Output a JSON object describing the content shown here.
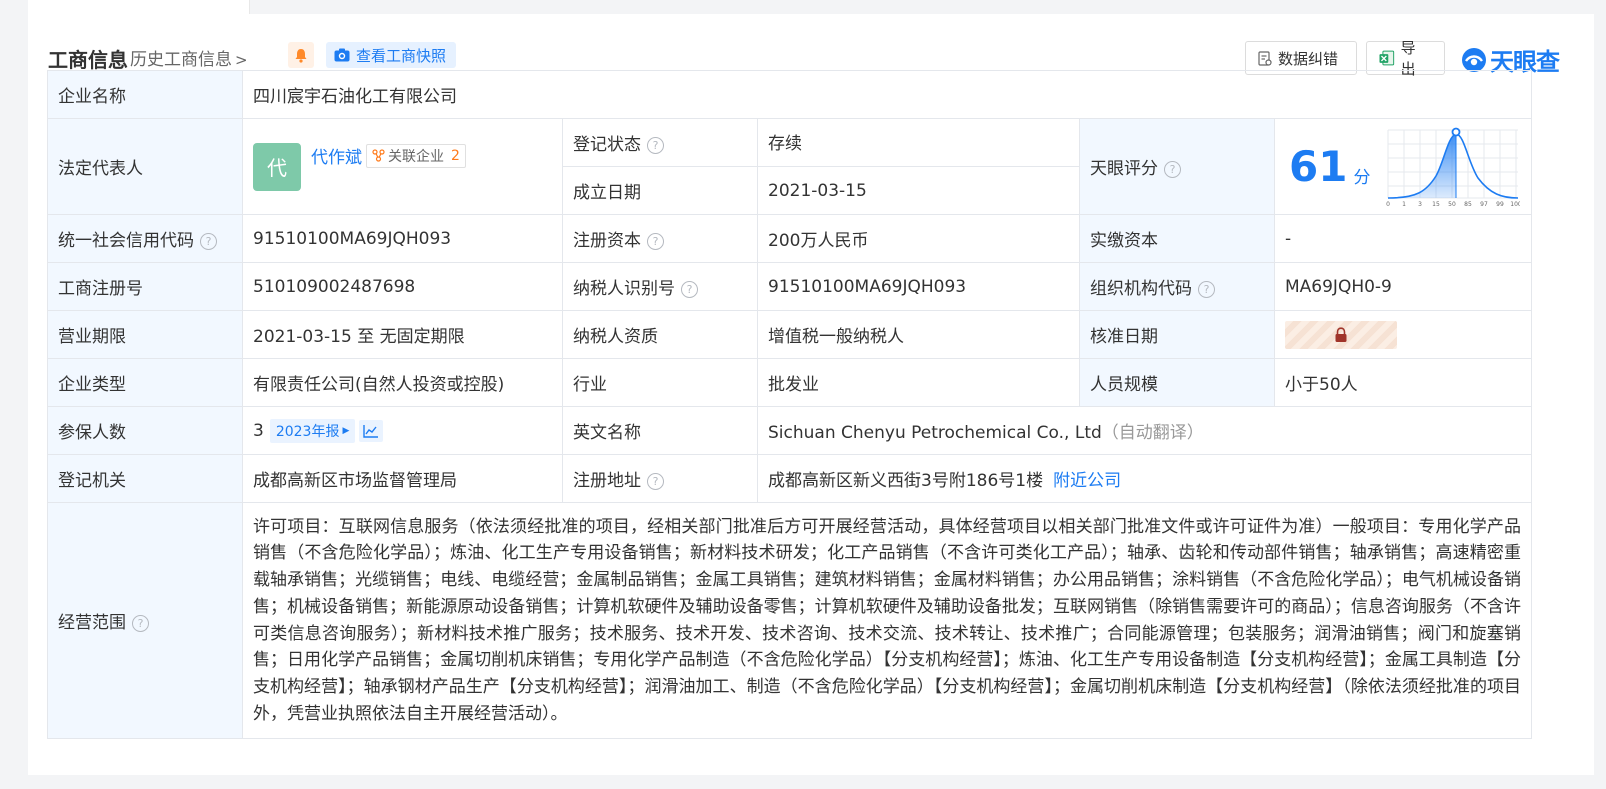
{
  "header": {
    "title": "工商信息",
    "history_link": "历史工商信息",
    "snapshot_button": "查看工商快照",
    "error_button": "数据纠错",
    "export_button": "导出",
    "logo_text": "天眼查",
    "brand_color": "#1d7cf2"
  },
  "company": {
    "name_label": "企业名称",
    "name": "四川宸宇石油化工有限公司",
    "legal_rep_label": "法定代表人",
    "legal_rep_avatar": "代",
    "legal_rep_name": "代作斌",
    "related_companies_label": "关联企业",
    "related_companies_count": "2",
    "reg_status_label": "登记状态",
    "reg_status": "存续",
    "found_date_label": "成立日期",
    "found_date": "2021-03-15",
    "tianyan_score_label": "天眼评分",
    "score": "61",
    "score_unit": "分",
    "score_axis": [
      "0",
      "1",
      "3",
      "15",
      "50",
      "85",
      "97",
      "99",
      "100"
    ],
    "credit_code_label": "统一社会信用代码",
    "credit_code": "91510100MA69JQH093",
    "reg_capital_label": "注册资本",
    "reg_capital": "200万人民币",
    "paid_capital_label": "实缴资本",
    "paid_capital": "-",
    "biz_reg_no_label": "工商注册号",
    "biz_reg_no": "510109002487698",
    "taxpayer_id_label": "纳税人识别号",
    "taxpayer_id": "91510100MA69JQH093",
    "org_code_label": "组织机构代码",
    "org_code": "MA69JQH0-9",
    "term_label": "营业期限",
    "term": "2021-03-15 至 无固定期限",
    "taxpayer_qual_label": "纳税人资质",
    "taxpayer_qual": "增值税一般纳税人",
    "approve_date_label": "核准日期",
    "company_type_label": "企业类型",
    "company_type": "有限责任公司(自然人投资或控股)",
    "industry_label": "行业",
    "industry": "批发业",
    "staff_size_label": "人员规模",
    "staff_size": "小于50人",
    "insured_label": "参保人数",
    "insured": "3",
    "annual_report_button": "2023年报",
    "english_name_label": "英文名称",
    "english_name": "Sichuan Chenyu Petrochemical Co., Ltd",
    "auto_translate": "（自动翻译）",
    "reg_authority_label": "登记机关",
    "reg_authority": "成都高新区市场监督管理局",
    "reg_address_label": "注册地址",
    "reg_address": "成都高新区新义西街3号附186号1楼",
    "nearby_link": "附近公司",
    "scope_label": "经营范围",
    "scope": "许可项目：互联网信息服务（依法须经批准的项目，经相关部门批准后方可开展经营活动，具体经营项目以相关部门批准文件或许可证件为准）一般项目：专用化学产品销售（不含危险化学品）；炼油、化工生产专用设备销售；新材料技术研发；化工产品销售（不含许可类化工产品）；轴承、齿轮和传动部件销售；轴承销售；高速精密重载轴承销售；光缆销售；电线、电缆经营；金属制品销售；金属工具销售；建筑材料销售；金属材料销售；办公用品销售；涂料销售（不含危险化学品）；电气机械设备销售；机械设备销售；新能源原动设备销售；计算机软硬件及辅助设备零售；计算机软硬件及辅助设备批发；互联网销售（除销售需要许可的商品）；信息咨询服务（不含许可类信息咨询服务）；新材料技术推广服务；技术服务、技术开发、技术咨询、技术交流、技术转让、技术推广；合同能源管理；包装服务；润滑油销售；阀门和旋塞销售；日用化学产品销售；金属切削机床销售；专用化学产品制造（不含危险化学品）【分支机构经营】；炼油、化工生产专用设备制造【分支机构经营】；金属工具制造【分支机构经营】；轴承钢材产品生产【分支机构经营】；润滑油加工、制造（不含危险化学品）【分支机构经营】；金属切削机床制造【分支机构经营】（除依法须经批准的项目外，凭营业执照依法自主开展经营活动）。"
  }
}
